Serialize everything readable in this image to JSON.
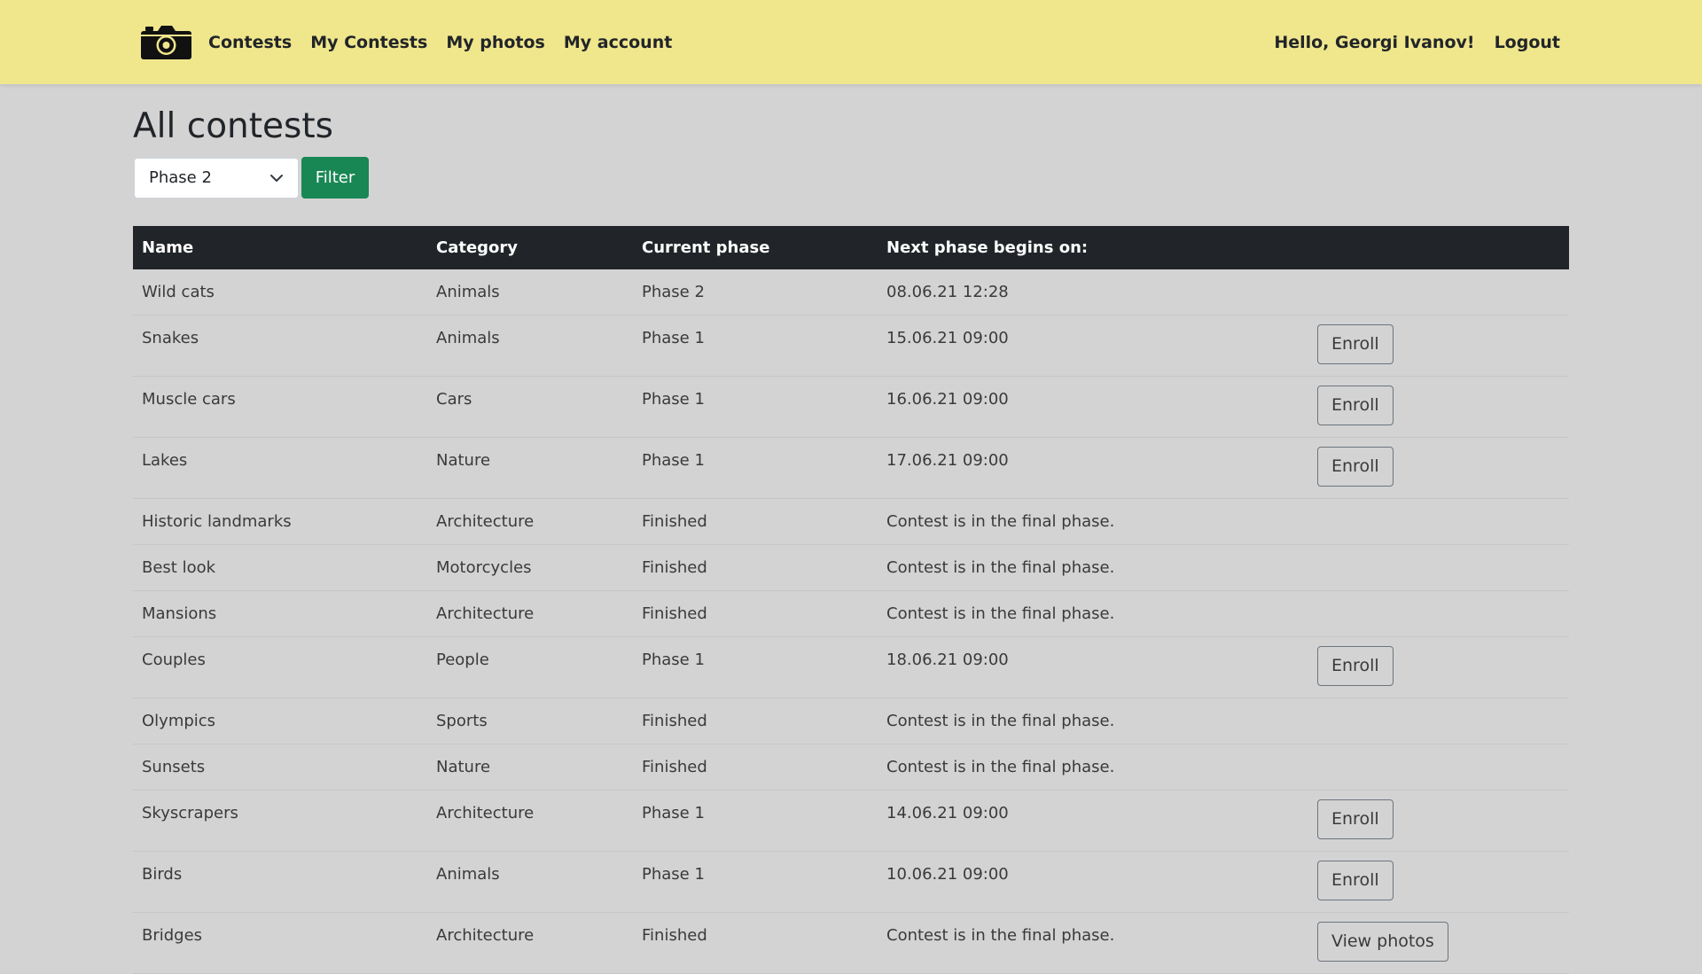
{
  "nav": {
    "brand_icon": "camera-icon",
    "links": [
      "Contests",
      "My Contests",
      "My photos",
      "My account"
    ],
    "greeting": "Hello, Georgi Ivanov!",
    "logout": "Logout"
  },
  "page": {
    "title": "All contests"
  },
  "filter": {
    "selected": "Phase 2",
    "button": "Filter"
  },
  "table": {
    "headers": {
      "name": "Name",
      "category": "Category",
      "phase": "Current phase",
      "next": "Next phase begins on:"
    },
    "rows": [
      {
        "name": "Wild cats",
        "category": "Animals",
        "phase": "Phase 2",
        "next": "08.06.21 12:28",
        "action": ""
      },
      {
        "name": "Snakes",
        "category": "Animals",
        "phase": "Phase 1",
        "next": "15.06.21 09:00",
        "action": "Enroll"
      },
      {
        "name": "Muscle cars",
        "category": "Cars",
        "phase": "Phase 1",
        "next": "16.06.21 09:00",
        "action": "Enroll"
      },
      {
        "name": "Lakes",
        "category": "Nature",
        "phase": "Phase 1",
        "next": "17.06.21 09:00",
        "action": "Enroll"
      },
      {
        "name": "Historic landmarks",
        "category": "Architecture",
        "phase": "Finished",
        "next": "Contest is in the final phase.",
        "action": ""
      },
      {
        "name": "Best look",
        "category": "Motorcycles",
        "phase": "Finished",
        "next": "Contest is in the final phase.",
        "action": ""
      },
      {
        "name": "Mansions",
        "category": "Architecture",
        "phase": "Finished",
        "next": "Contest is in the final phase.",
        "action": ""
      },
      {
        "name": "Couples",
        "category": "People",
        "phase": "Phase 1",
        "next": "18.06.21 09:00",
        "action": "Enroll"
      },
      {
        "name": "Olympics",
        "category": "Sports",
        "phase": "Finished",
        "next": "Contest is in the final phase.",
        "action": ""
      },
      {
        "name": "Sunsets",
        "category": "Nature",
        "phase": "Finished",
        "next": "Contest is in the final phase.",
        "action": ""
      },
      {
        "name": "Skyscrapers",
        "category": "Architecture",
        "phase": "Phase 1",
        "next": "14.06.21 09:00",
        "action": "Enroll"
      },
      {
        "name": "Birds",
        "category": "Animals",
        "phase": "Phase 1",
        "next": "10.06.21 09:00",
        "action": "Enroll"
      },
      {
        "name": "Bridges",
        "category": "Architecture",
        "phase": "Finished",
        "next": "Contest is in the final phase.",
        "action": "View photos"
      }
    ]
  }
}
